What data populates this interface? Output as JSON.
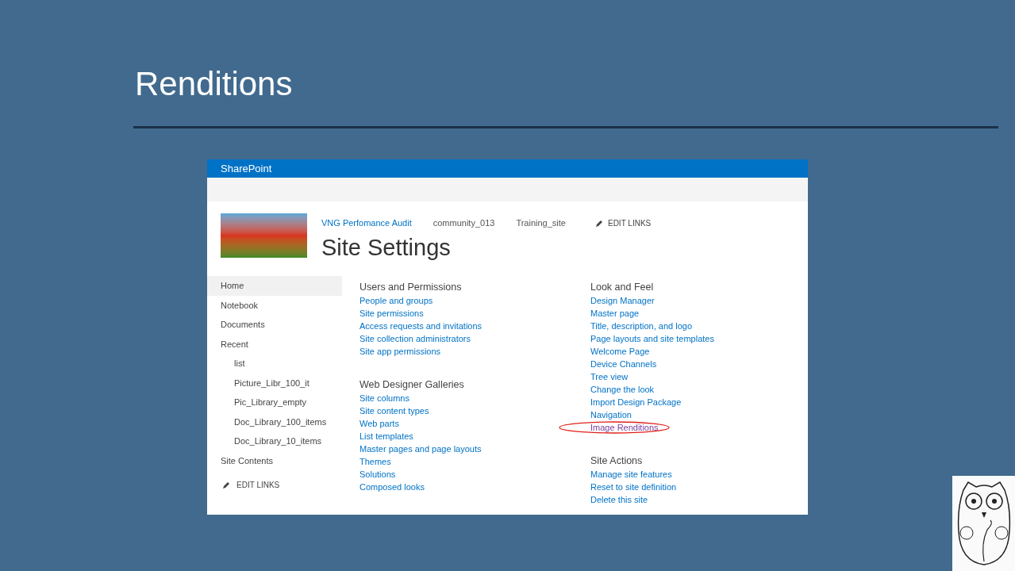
{
  "slide": {
    "title": "Renditions"
  },
  "app": {
    "brand": "SharePoint",
    "top_links": [
      {
        "label": "VNG Perfomance Audit",
        "selected": true
      },
      {
        "label": "community_013",
        "selected": false
      },
      {
        "label": "Training_site",
        "selected": false
      }
    ],
    "top_edit_links": "EDIT LINKS",
    "page_title": "Site Settings",
    "nav": [
      {
        "label": "Home",
        "selected": true
      },
      {
        "label": "Notebook",
        "selected": false
      },
      {
        "label": "Documents",
        "selected": false
      },
      {
        "label": "Recent",
        "selected": false,
        "children": [
          {
            "label": "list",
            "selected": false
          },
          {
            "label": "Picture_Libr_100_it",
            "selected": false
          },
          {
            "label": "Pic_Library_empty",
            "selected": false
          },
          {
            "label": "Doc_Library_100_items",
            "selected": false
          },
          {
            "label": "Doc_Library_10_items",
            "selected": false
          }
        ]
      },
      {
        "label": "Site Contents",
        "selected": false
      }
    ],
    "nav_edit_links": "EDIT LINKS",
    "columns": [
      [
        {
          "heading": "Users and Permissions",
          "links": [
            {
              "label": "People and groups",
              "visited": false,
              "circled": false
            },
            {
              "label": "Site permissions",
              "visited": false,
              "circled": false
            },
            {
              "label": "Access requests and invitations",
              "visited": false,
              "circled": false
            },
            {
              "label": "Site collection administrators",
              "visited": false,
              "circled": false
            },
            {
              "label": "Site app permissions",
              "visited": false,
              "circled": false
            }
          ]
        },
        {
          "heading": "Web Designer Galleries",
          "links": [
            {
              "label": "Site columns",
              "visited": false,
              "circled": false
            },
            {
              "label": "Site content types",
              "visited": false,
              "circled": false
            },
            {
              "label": "Web parts",
              "visited": false,
              "circled": false
            },
            {
              "label": "List templates",
              "visited": false,
              "circled": false
            },
            {
              "label": "Master pages and page layouts",
              "visited": false,
              "circled": false
            },
            {
              "label": "Themes",
              "visited": false,
              "circled": false
            },
            {
              "label": "Solutions",
              "visited": false,
              "circled": false
            },
            {
              "label": "Composed looks",
              "visited": false,
              "circled": false
            }
          ]
        }
      ],
      [
        {
          "heading": "Look and Feel",
          "links": [
            {
              "label": "Design Manager",
              "visited": false,
              "circled": false
            },
            {
              "label": "Master page",
              "visited": false,
              "circled": false
            },
            {
              "label": "Title, description, and logo",
              "visited": false,
              "circled": false
            },
            {
              "label": "Page layouts and site templates",
              "visited": false,
              "circled": false
            },
            {
              "label": "Welcome Page",
              "visited": false,
              "circled": false
            },
            {
              "label": "Device Channels",
              "visited": false,
              "circled": false
            },
            {
              "label": "Tree view",
              "visited": false,
              "circled": false
            },
            {
              "label": "Change the look",
              "visited": false,
              "circled": false
            },
            {
              "label": "Import Design Package",
              "visited": false,
              "circled": false
            },
            {
              "label": "Navigation",
              "visited": false,
              "circled": false
            },
            {
              "label": "Image Renditions",
              "visited": true,
              "circled": true
            }
          ]
        },
        {
          "heading": "Site Actions",
          "links": [
            {
              "label": "Manage site features",
              "visited": false,
              "circled": false
            },
            {
              "label": "Reset to site definition",
              "visited": false,
              "circled": false
            },
            {
              "label": "Delete this site",
              "visited": false,
              "circled": false
            }
          ]
        }
      ]
    ]
  }
}
